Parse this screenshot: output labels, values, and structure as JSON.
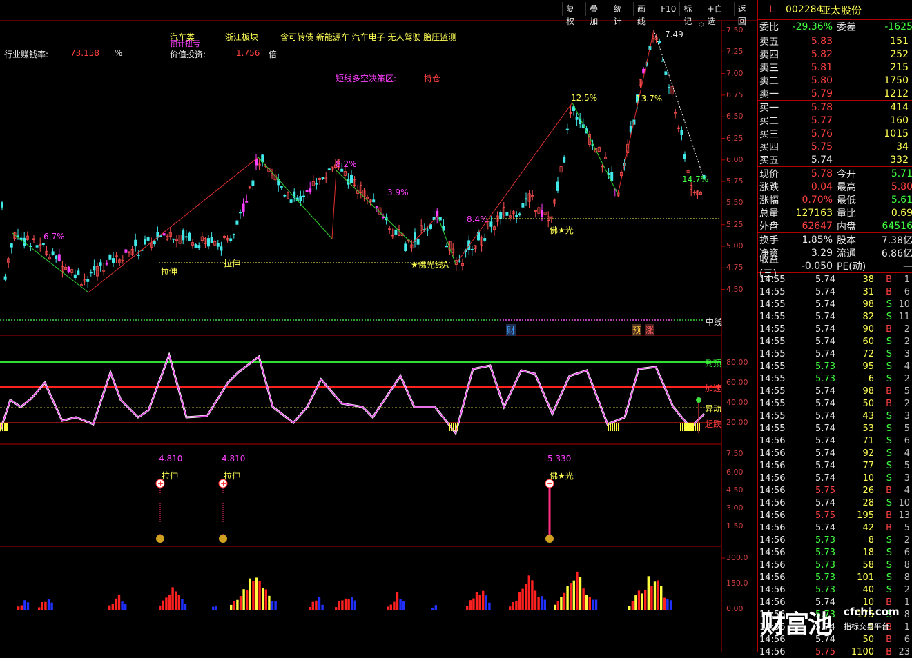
{
  "toolbar": [
    "复权",
    "叠加",
    "统计",
    "画线",
    "F10",
    "标记",
    "+自选",
    "返回"
  ],
  "header": {
    "sector1": "汽车类",
    "sector1_sub": "预计扭亏",
    "sector2": "浙江板块",
    "concepts": "含可转债 新能源车 汽车电子 无人驾驶 胎压监测",
    "row2_label": "行业赚钱率:",
    "row2_value": "73.158",
    "row2_unit": "%",
    "row2b_label": "价值投资:",
    "row2b_value": "1.756",
    "row2b_unit": "倍",
    "decision_label": "短线多空决策区:",
    "decision_value": "持仓"
  },
  "main_chart": {
    "price_ticks": [
      "7.50",
      "7.25",
      "7.00",
      "6.75",
      "6.50",
      "6.25",
      "6.00",
      "5.75",
      "5.50",
      "5.25",
      "5.00",
      "4.75",
      "4.50"
    ],
    "annotations": [
      {
        "text": "6.7%"
      },
      {
        "text": "8.2%"
      },
      {
        "text": "3.9%"
      },
      {
        "text": "8.4%"
      },
      {
        "text": "12.5%"
      },
      {
        "text": "13.7%"
      },
      {
        "text": "14.7%"
      },
      {
        "text": "7.49"
      }
    ],
    "markers": [
      {
        "text": "拉伸"
      },
      {
        "text": "拉伸"
      },
      {
        "text": "★佛光线A"
      },
      {
        "text": "佛★光"
      }
    ],
    "midline_label": "中线",
    "tags": [
      "财",
      "预",
      "涨"
    ]
  },
  "oscillator": {
    "ticks": [
      "80.00",
      "60.00",
      "40.00",
      "20.00"
    ],
    "labels": [
      "到顶",
      "加速",
      "异动",
      "超跌"
    ]
  },
  "signal_panel": {
    "ticks": [
      "7.50",
      "6.00",
      "4.50",
      "3.00",
      "1.50"
    ],
    "signals": [
      {
        "value": "4.810",
        "label": "拉伸"
      },
      {
        "value": "4.810",
        "label": "拉伸"
      },
      {
        "value": "5.330",
        "label": "佛★光"
      }
    ]
  },
  "volume_panel": {
    "ticks": [
      "300.0",
      "150.0",
      "0.00"
    ]
  },
  "quote": {
    "flag": "L",
    "code": "002284",
    "name": "亚太股份",
    "weibi_label": "委比",
    "weibi": "-29.36%",
    "weicha_label": "委差",
    "weicha": "-1625",
    "asks": [
      {
        "label": "卖五",
        "price": "5.83",
        "vol": "151"
      },
      {
        "label": "卖四",
        "price": "5.82",
        "vol": "252"
      },
      {
        "label": "卖三",
        "price": "5.81",
        "vol": "215"
      },
      {
        "label": "卖二",
        "price": "5.80",
        "vol": "1750"
      },
      {
        "label": "卖一",
        "price": "5.79",
        "vol": "1212"
      }
    ],
    "bids": [
      {
        "label": "买一",
        "price": "5.78",
        "vol": "414"
      },
      {
        "label": "买二",
        "price": "5.77",
        "vol": "160"
      },
      {
        "label": "买三",
        "price": "5.76",
        "vol": "1015"
      },
      {
        "label": "买四",
        "price": "5.75",
        "vol": "34"
      },
      {
        "label": "买五",
        "price": "5.74",
        "vol": "332"
      }
    ],
    "stats1": [
      {
        "l1": "现价",
        "v1": "5.78",
        "c1": "#ff4040",
        "l2": "今开",
        "v2": "5.71",
        "c2": "#40ff40"
      },
      {
        "l1": "涨跌",
        "v1": "0.04",
        "c1": "#ff4040",
        "l2": "最高",
        "v2": "5.80",
        "c2": "#ff4040"
      },
      {
        "l1": "涨幅",
        "v1": "0.70%",
        "c1": "#ff4040",
        "l2": "最低",
        "v2": "5.61",
        "c2": "#40ff40"
      },
      {
        "l1": "总量",
        "v1": "127163",
        "c1": "#ffff54",
        "l2": "量比",
        "v2": "0.69",
        "c2": "#ffff54"
      },
      {
        "l1": "外盘",
        "v1": "62647",
        "c1": "#ff4040",
        "l2": "内盘",
        "v2": "64516",
        "c2": "#40ff40"
      }
    ],
    "stats2": [
      {
        "l1": "换手",
        "v1": "1.85%",
        "l2": "股本",
        "v2": "7.38亿"
      },
      {
        "l1": "净资",
        "v1": "3.29",
        "l2": "流通",
        "v2": "6.86亿"
      },
      {
        "l1": "收益(三)",
        "v1": "-0.050",
        "l2": "PE(动)",
        "v2": "—"
      }
    ],
    "ticks": [
      {
        "t": "14:55",
        "p": "5.74",
        "v": "38",
        "bs": "B",
        "n": "1"
      },
      {
        "t": "14:55",
        "p": "5.74",
        "v": "31",
        "bs": "B",
        "n": "6"
      },
      {
        "t": "14:55",
        "p": "5.74",
        "v": "98",
        "bs": "S",
        "n": "10"
      },
      {
        "t": "14:55",
        "p": "5.74",
        "v": "82",
        "bs": "S",
        "n": "11"
      },
      {
        "t": "14:55",
        "p": "5.74",
        "v": "90",
        "bs": "B",
        "n": "2"
      },
      {
        "t": "14:55",
        "p": "5.74",
        "v": "60",
        "bs": "S",
        "n": "2"
      },
      {
        "t": "14:55",
        "p": "5.74",
        "v": "72",
        "bs": "S",
        "n": "3"
      },
      {
        "t": "14:55",
        "p": "5.73",
        "v": "95",
        "bs": "S",
        "n": "4"
      },
      {
        "t": "14:55",
        "p": "5.73",
        "v": "6",
        "bs": "S",
        "n": "2"
      },
      {
        "t": "14:55",
        "p": "5.74",
        "v": "98",
        "bs": "B",
        "n": "5"
      },
      {
        "t": "14:55",
        "p": "5.74",
        "v": "50",
        "bs": "B",
        "n": "2"
      },
      {
        "t": "14:55",
        "p": "5.74",
        "v": "43",
        "bs": "S",
        "n": "3"
      },
      {
        "t": "14:55",
        "p": "5.74",
        "v": "53",
        "bs": "S",
        "n": "5"
      },
      {
        "t": "14:56",
        "p": "5.74",
        "v": "71",
        "bs": "S",
        "n": "6"
      },
      {
        "t": "14:56",
        "p": "5.74",
        "v": "92",
        "bs": "S",
        "n": "4"
      },
      {
        "t": "14:56",
        "p": "5.74",
        "v": "77",
        "bs": "S",
        "n": "5"
      },
      {
        "t": "14:56",
        "p": "5.74",
        "v": "10",
        "bs": "S",
        "n": "3"
      },
      {
        "t": "14:56",
        "p": "5.75",
        "v": "26",
        "bs": "B",
        "n": "4"
      },
      {
        "t": "14:56",
        "p": "5.74",
        "v": "28",
        "bs": "S",
        "n": "10"
      },
      {
        "t": "14:56",
        "p": "5.75",
        "v": "195",
        "bs": "B",
        "n": "13"
      },
      {
        "t": "14:56",
        "p": "5.74",
        "v": "42",
        "bs": "B",
        "n": "5"
      },
      {
        "t": "14:56",
        "p": "5.73",
        "v": "8",
        "bs": "S",
        "n": "2"
      },
      {
        "t": "14:56",
        "p": "5.73",
        "v": "18",
        "bs": "S",
        "n": "6"
      },
      {
        "t": "14:56",
        "p": "5.73",
        "v": "58",
        "bs": "S",
        "n": "8"
      },
      {
        "t": "14:56",
        "p": "5.73",
        "v": "101",
        "bs": "S",
        "n": "8"
      },
      {
        "t": "14:56",
        "p": "5.73",
        "v": "40",
        "bs": "S",
        "n": "2"
      },
      {
        "t": "14:56",
        "p": "5.74",
        "v": "10",
        "bs": "B",
        "n": "1"
      },
      {
        "t": "14:56",
        "p": "5.73",
        "v": "175",
        "bs": "S",
        "n": "8"
      },
      {
        "t": "14:56",
        "p": "5.74",
        "v": "5",
        "bs": "B",
        "n": "1"
      },
      {
        "t": "14:56",
        "p": "5.74",
        "v": "50",
        "bs": "B",
        "n": "6"
      },
      {
        "t": "14:56",
        "p": "5.75",
        "v": "1100",
        "bs": "B",
        "n": "23"
      }
    ]
  },
  "watermark": {
    "big": "财富池",
    "url": "cfchi.com",
    "sub": "指标交易平台"
  }
}
